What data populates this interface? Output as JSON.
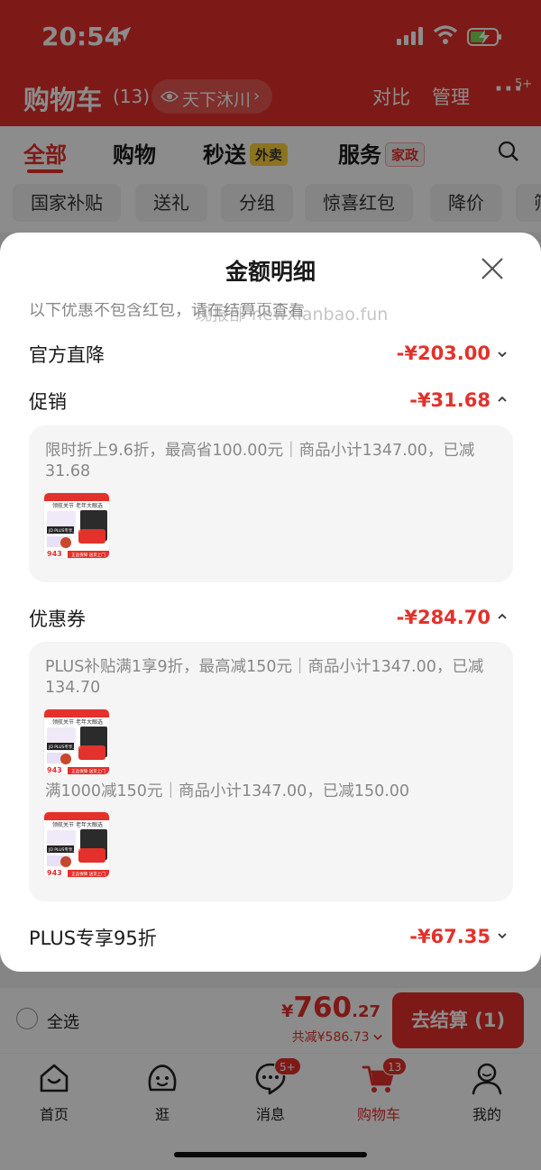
{
  "status": {
    "time": "20:54"
  },
  "header": {
    "title": "购物车",
    "count": "(13)",
    "address": "天下沐川",
    "compare": "对比",
    "manage": "管理",
    "more_badge": "5+"
  },
  "tabs": [
    {
      "label": "全部"
    },
    {
      "label": "购物"
    },
    {
      "label": "秒送",
      "tag": "外卖"
    },
    {
      "label": "服务",
      "tag": "家政"
    }
  ],
  "chips": [
    "国家补贴",
    "送礼",
    "分组",
    "惊喜红包",
    "降价",
    "筛"
  ],
  "sheet": {
    "title": "金额明细",
    "note": "以下优惠不包含红包，请在结算页查看",
    "watermark": "现报部 newxianbao.fun",
    "rows": [
      {
        "label": "官方直降",
        "amount": "-¥203.00"
      },
      {
        "label": "促销",
        "amount": "-¥31.68"
      },
      {
        "label": "优惠券",
        "amount": "-¥284.70"
      },
      {
        "label": "PLUS专享95折",
        "amount": "-¥67.35"
      }
    ],
    "promo_text": "限时折上9.6折，最高省100.00元｜商品小计1347.00，已减31.68",
    "coupon_text_1": "PLUS补贴满1享9折，最高减150元｜商品小计1347.00，已减134.70",
    "coupon_text_2": "满1000减150元｜商品小计1347.00，已减150.00",
    "thumb": {
      "headline": "领航关节 老年大眼选",
      "badge": "JD PLUS专享上价",
      "price": "943",
      "footer": "正品保障 送货上门"
    }
  },
  "checkout": {
    "select_all": "全选",
    "currency": "¥",
    "total_int": "760",
    "total_dec": ".27",
    "saved": "共减¥586.73",
    "pay_label": "去结算 (1)"
  },
  "nav": [
    {
      "label": "首页"
    },
    {
      "label": "逛"
    },
    {
      "label": "消息",
      "badge": "5+"
    },
    {
      "label": "购物车",
      "badge": "13"
    },
    {
      "label": "我的"
    }
  ],
  "colors": {
    "accent": "#e3312b",
    "sheet_bg": "#ffffff",
    "box_bg": "#f5f5f5"
  }
}
